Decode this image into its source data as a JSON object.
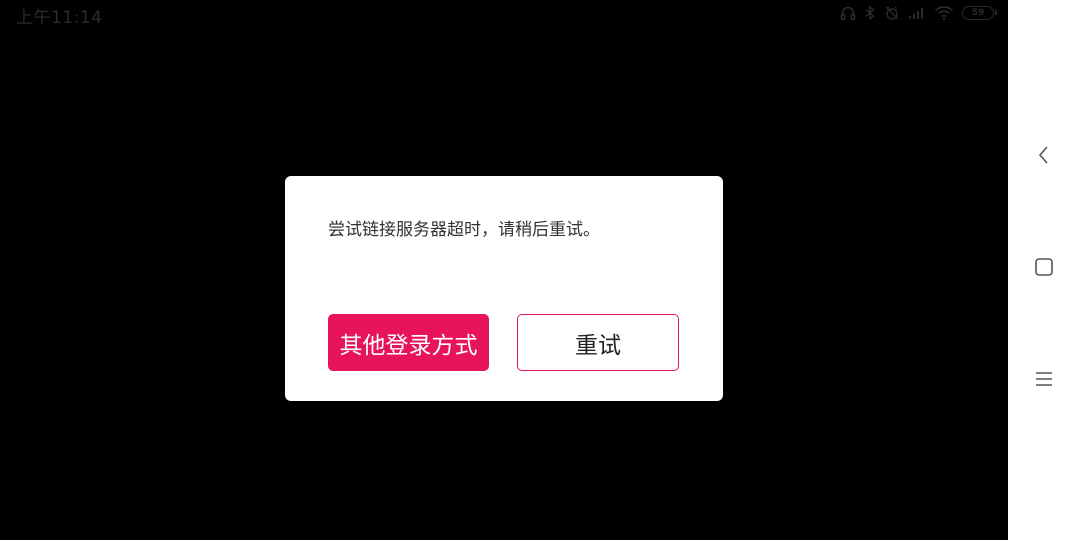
{
  "status_bar": {
    "time": "上午11:14",
    "battery_level": "59",
    "icons": [
      "headphones-icon",
      "bluetooth-icon",
      "alarm-off-icon",
      "signal-icon",
      "wifi-icon",
      "battery-icon"
    ]
  },
  "dialog": {
    "message": "尝试链接服务器超时，请稍后重试。",
    "primary_button_label": "其他登录方式",
    "secondary_button_label": "重试"
  },
  "nav_bar": {
    "icons": [
      "back-icon",
      "home-icon",
      "menu-icon"
    ]
  },
  "colors": {
    "accent": "#e8145a",
    "background": "#000000",
    "nav_background": "#ffffff"
  }
}
